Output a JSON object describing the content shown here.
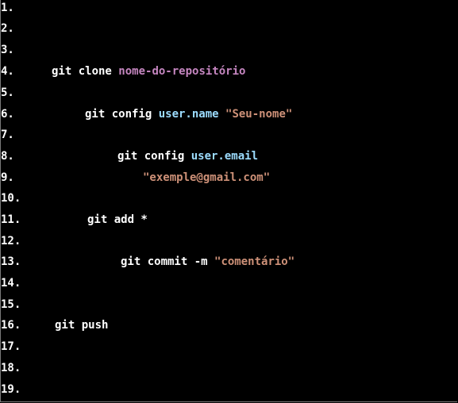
{
  "editor": {
    "colors": {
      "background": "#000000",
      "line_number": "#ffffff",
      "command": "#ffffff",
      "argument": "#c586c0",
      "key": "#9cdcfe",
      "string": "#ce9178"
    },
    "lines": [
      {
        "number": "1.",
        "tokens": []
      },
      {
        "number": "2.",
        "tokens": []
      },
      {
        "number": "3.",
        "tokens": []
      },
      {
        "number": "4.",
        "tokens": [
          {
            "text": "git clone ",
            "kind": "command"
          },
          {
            "text": "nome-do-repositório",
            "kind": "argument"
          }
        ]
      },
      {
        "number": "5.",
        "tokens": []
      },
      {
        "number": "6.",
        "tokens": [
          {
            "text": "git config ",
            "kind": "command"
          },
          {
            "text": "user.name",
            "kind": "key"
          },
          {
            "text": " ",
            "kind": "command"
          },
          {
            "text": "\"Seu-nome\"",
            "kind": "string"
          }
        ]
      },
      {
        "number": "7.",
        "tokens": []
      },
      {
        "number": "8.",
        "tokens": [
          {
            "text": "git config ",
            "kind": "command"
          },
          {
            "text": "user.email",
            "kind": "key"
          }
        ]
      },
      {
        "number": "9.",
        "tokens": [
          {
            "text": "\"exemple@gmail.com\"",
            "kind": "string"
          }
        ]
      },
      {
        "number": "10.",
        "tokens": []
      },
      {
        "number": "11.",
        "tokens": [
          {
            "text": "git add *",
            "kind": "command"
          }
        ]
      },
      {
        "number": "12.",
        "tokens": []
      },
      {
        "number": "13.",
        "tokens": [
          {
            "text": "git commit -m ",
            "kind": "command"
          },
          {
            "text": "\"comentário\"",
            "kind": "string"
          }
        ]
      },
      {
        "number": "14.",
        "tokens": []
      },
      {
        "number": "15.",
        "tokens": []
      },
      {
        "number": "16.",
        "tokens": [
          {
            "text": "git push",
            "kind": "command"
          }
        ]
      },
      {
        "number": "17.",
        "tokens": []
      },
      {
        "number": "18.",
        "tokens": []
      },
      {
        "number": "19.",
        "tokens": []
      }
    ]
  }
}
